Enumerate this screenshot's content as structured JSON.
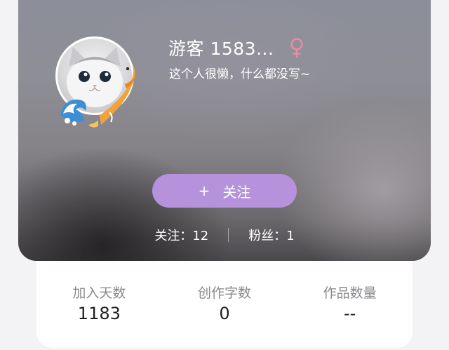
{
  "profile": {
    "username": "游客 1583...",
    "gender_icon": "female-icon",
    "gender_color": "#f08aa6",
    "bio": "这个人很懒，什么都没写~",
    "avatar": "cat-avatar"
  },
  "follow_button": {
    "icon": "+",
    "label": "关注",
    "color": "#b792dc"
  },
  "counts": {
    "following": "关注：12",
    "followers": "粉丝：1"
  },
  "stats": [
    {
      "label": "加入天数",
      "value": "1183"
    },
    {
      "label": "创作字数",
      "value": "0"
    },
    {
      "label": "作品数量",
      "value": "--"
    }
  ]
}
